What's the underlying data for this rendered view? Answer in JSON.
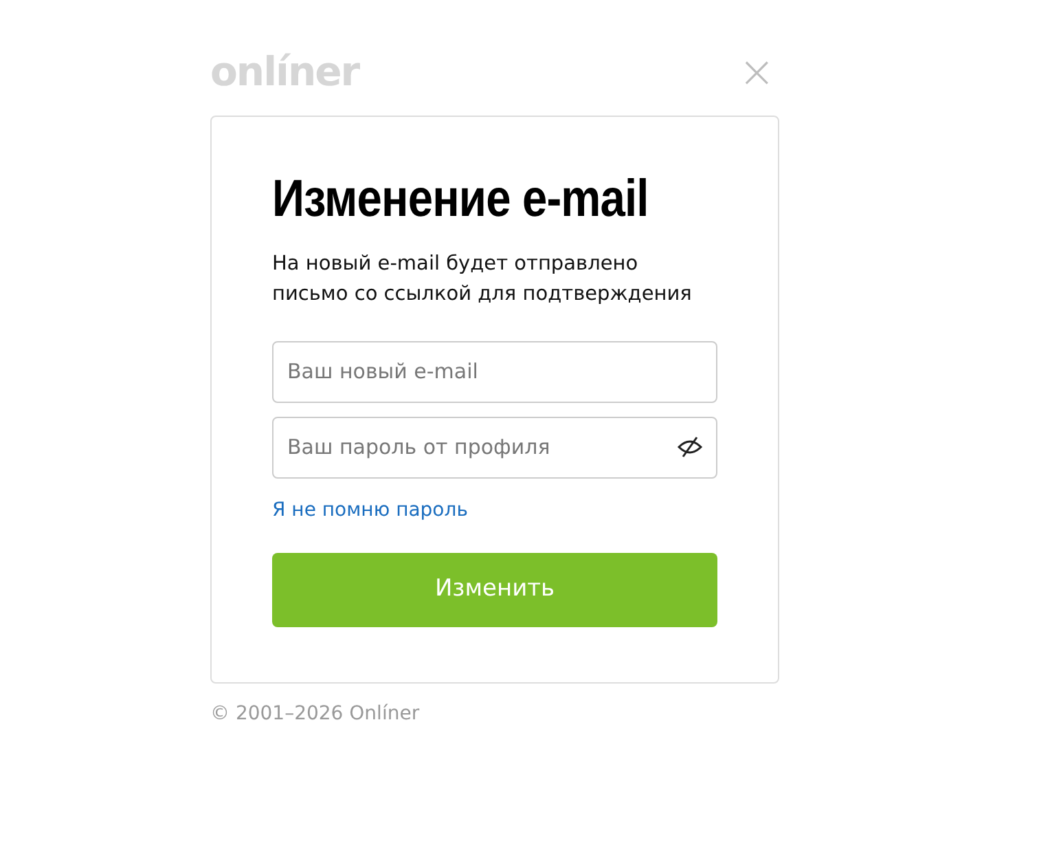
{
  "logo": "onlíner",
  "close_button": "×",
  "title": "Изменение e-mail",
  "description": "На новый e-mail будет отправлено письмо со ссылкой для подтверждения",
  "fields": [
    {
      "kind": "email",
      "placeholder": "Ваш новый e-mail"
    },
    {
      "kind": "password",
      "placeholder": "Ваш пароль от профиля"
    }
  ],
  "forgot_link": "Я не помню пароль",
  "submit_button": "Изменить",
  "footer": "© 2001–2026 Onlíner"
}
